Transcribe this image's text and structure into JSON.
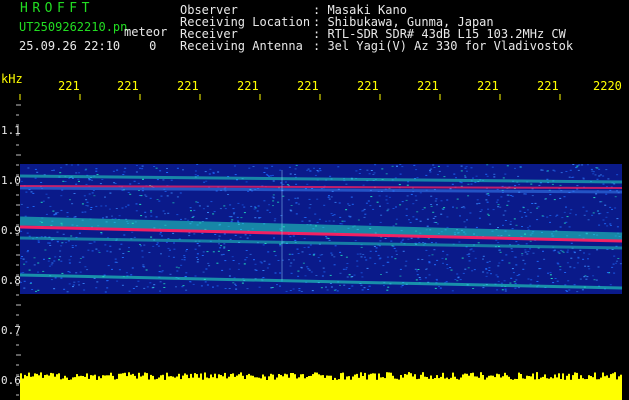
{
  "header": {
    "app_title": "HROFFT",
    "filename": "UT2509262210.pn",
    "mode": "meteor",
    "datetime": "25.09.26 22:10",
    "counter": "0"
  },
  "info": [
    {
      "key": "Observer",
      "value": ": Masaki Kano"
    },
    {
      "key": "Receiving Location",
      "value": ": Shibukawa, Gunma, Japan"
    },
    {
      "key": "Receiver",
      "value": ": RTL-SDR SDR# 43dB L15 103.2MHz CW"
    },
    {
      "key": "Receiving Antenna",
      "value": ": 3el Yagi(V) Az 330 for Vladivostok"
    }
  ],
  "axis": {
    "unit": "kHz",
    "time_ticks": [
      "221",
      "221",
      "221",
      "221",
      "221",
      "221",
      "221",
      "221",
      "221",
      "2220"
    ],
    "freq_labels": [
      "1.1",
      "1.0",
      "0.9",
      "0.8",
      "0.7",
      "0.6"
    ]
  },
  "colors": {
    "background": "#000000",
    "grid_tick": "#ffff00",
    "signal_line": "#ff2060",
    "noise_floor": "#ffff00",
    "spectrum_low": "#0a1a8a",
    "spectrum_mid": "#1e6cff",
    "spectrum_high": "#22e0c0"
  }
}
